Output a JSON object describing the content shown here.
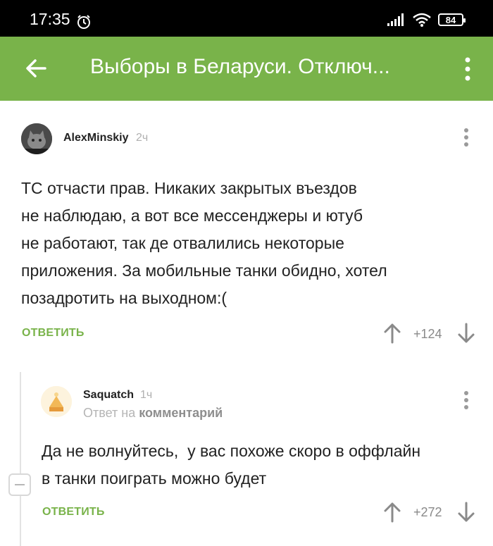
{
  "status_bar": {
    "time": "17:35",
    "battery": "84"
  },
  "app_bar": {
    "title": "Выборы в Беларуси. Отключ..."
  },
  "comments": [
    {
      "author": "AlexMinskiy",
      "time": "2ч",
      "text_lines": [
        "ТС отчасти прав. Никаких закрытых въездов",
        "не наблюдаю, а вот все мессенджеры и ютуб",
        "не работают, так де отвалились некоторые",
        "приложения. За мобильные танки обидно, хотел",
        "позадротить на выходном:("
      ],
      "reply_label": "ОТВЕТИТЬ",
      "score": "+124"
    },
    {
      "author": "Saquatch",
      "time": "1ч",
      "reply_prefix": "Ответ на",
      "reply_target": "комментарий",
      "text_lines": [
        "Да не волнуйтесь,  у вас похоже скоро в оффлайн",
        "в танки поиграть можно будет"
      ],
      "reply_label": "ОТВЕТИТЬ",
      "score": "+272"
    }
  ],
  "colors": {
    "accent": "#79b34a",
    "status_bar": "#000000"
  }
}
